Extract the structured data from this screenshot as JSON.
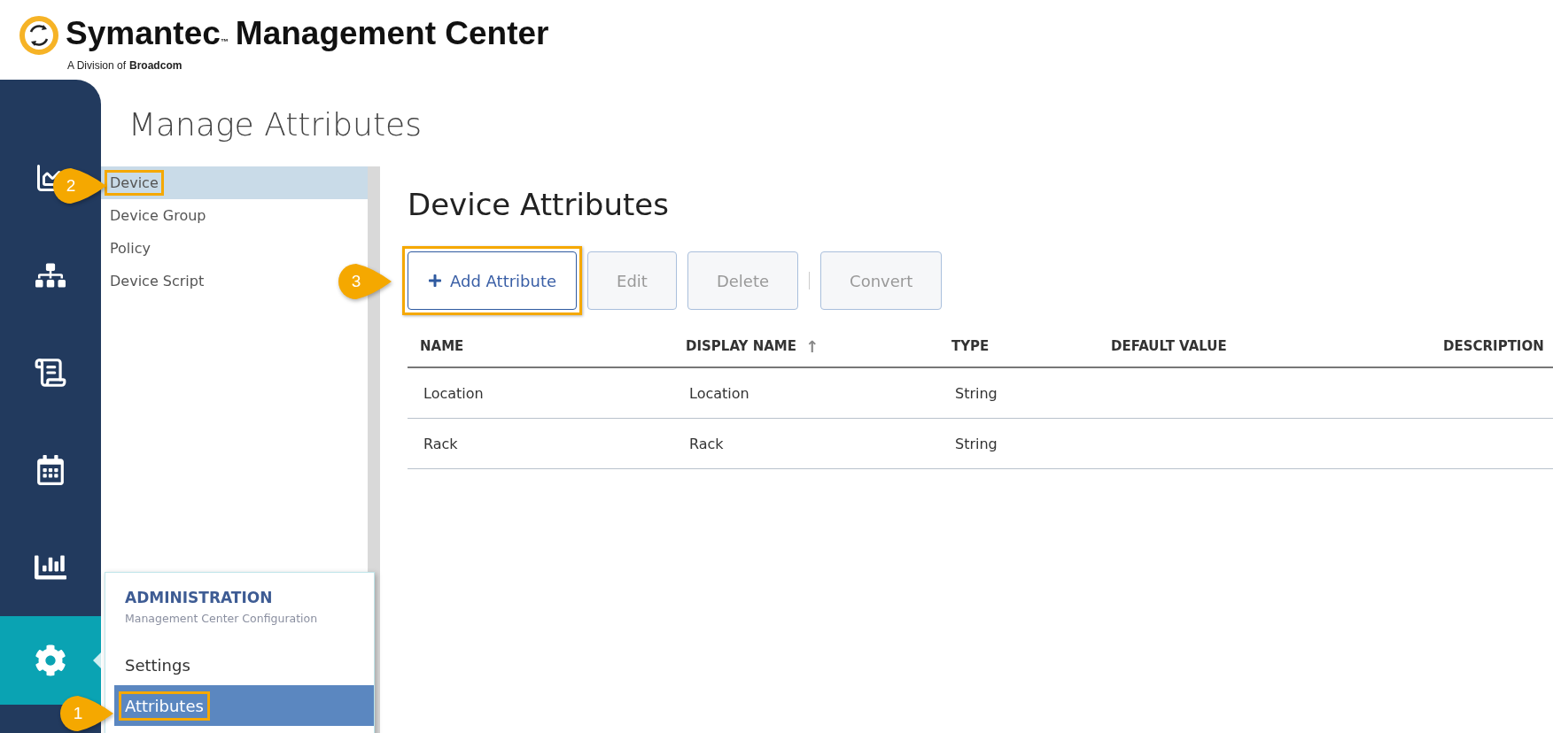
{
  "header": {
    "brand": "Symantec",
    "trademark": "™",
    "product": "Management Center",
    "tagline_prefix": "A Division of",
    "tagline_company": "Broadcom"
  },
  "nav": [
    {
      "selected": false
    },
    {
      "selected": false
    },
    {
      "selected": false
    },
    {
      "selected": false
    },
    {
      "selected": false
    },
    {
      "selected": true
    }
  ],
  "page_title": "Manage Attributes",
  "sidebar": {
    "items": [
      {
        "label": "Device",
        "selected": true,
        "annotated": true
      },
      {
        "label": "Device Group",
        "selected": false,
        "annotated": false
      },
      {
        "label": "Policy",
        "selected": false,
        "annotated": false
      },
      {
        "label": "Device Script",
        "selected": false,
        "annotated": false
      }
    ]
  },
  "main": {
    "title": "Device Attributes",
    "button_groups": [
      [
        {
          "label": "Add Attribute",
          "kind": "add",
          "disabled": false,
          "annotated": true
        },
        {
          "label": "Edit",
          "kind": "plain",
          "disabled": true,
          "annotated": false
        },
        {
          "label": "Delete",
          "kind": "plain",
          "disabled": true,
          "annotated": false
        }
      ],
      [
        {
          "label": "Convert",
          "kind": "plain",
          "disabled": true,
          "annotated": false
        }
      ]
    ],
    "table": {
      "columns": [
        {
          "label": "NAME"
        },
        {
          "label": "DISPLAY NAME",
          "sort_arrow": "↑"
        },
        {
          "label": "TYPE"
        },
        {
          "label": "DEFAULT VALUE"
        },
        {
          "label": "DESCRIPTION"
        }
      ],
      "rows": [
        [
          "Location",
          "Location",
          "String",
          "",
          ""
        ],
        [
          "Rack",
          "Rack",
          "String",
          "",
          ""
        ]
      ]
    }
  },
  "admin_menu": {
    "title": "ADMINISTRATION",
    "subtitle": "Management Center Configuration",
    "items": [
      {
        "label": "Settings",
        "selected": false,
        "annotated": false
      },
      {
        "label": "Attributes",
        "selected": true,
        "annotated": true
      }
    ]
  },
  "callouts": [
    {
      "number": "1"
    },
    {
      "number": "2"
    },
    {
      "number": "3"
    }
  ]
}
